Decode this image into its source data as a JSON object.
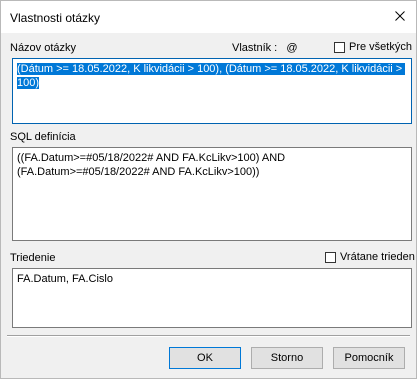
{
  "window": {
    "title": "Vlastnosti otázky"
  },
  "name_section": {
    "label": "Názov otázky",
    "owner_label": "Vlastník :",
    "owner_value": "@",
    "for_all_label": "Pre všetkých",
    "for_all_checked": false,
    "value": "(Dátum >= 18.05.2022, K likvidácii > 100), (Dátum >= 18.05.2022, K likvidácii > 100)"
  },
  "sql_section": {
    "label": "SQL definícia",
    "value": "((FA.Datum>=#05/18/2022# AND FA.KcLikv>100) AND (FA.Datum>=#05/18/2022# AND FA.KcLikv>100))"
  },
  "sort_section": {
    "label": "Triedenie",
    "including_label": "Vrátane trieden",
    "including_checked": false,
    "value": "FA.Datum, FA.Cislo"
  },
  "buttons": {
    "ok": "OK",
    "cancel": "Storno",
    "help": "Pomocník"
  },
  "colors": {
    "selection": "#0078d7",
    "focus_border": "#0063b1",
    "dialog_bg": "#f0f0f0"
  }
}
